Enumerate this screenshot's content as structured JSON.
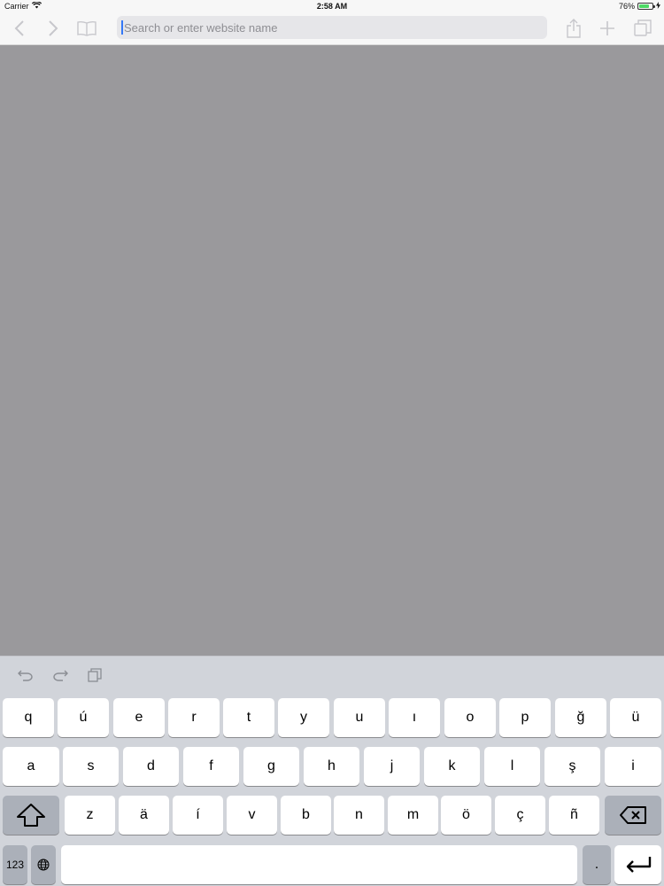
{
  "status_bar": {
    "carrier": "Carrier",
    "time": "2:58 AM",
    "battery": "76%"
  },
  "toolbar": {
    "search_placeholder": "Search or enter website name",
    "icons": [
      "back-icon",
      "forward-icon",
      "bookmarks-icon",
      "share-icon",
      "new-tab-icon",
      "tabs-icon"
    ]
  },
  "keyboard": {
    "shortcuts": [
      "undo-icon",
      "redo-icon",
      "paste-icon"
    ],
    "row1": [
      "q",
      "ú",
      "e",
      "r",
      "t",
      "y",
      "u",
      "ı",
      "o",
      "p",
      "ğ",
      "ü"
    ],
    "row2": [
      "a",
      "s",
      "d",
      "f",
      "g",
      "h",
      "j",
      "k",
      "l",
      "ş",
      "i"
    ],
    "row3": [
      "z",
      "ä",
      "í",
      "v",
      "b",
      "n",
      "m",
      "ö",
      "ç",
      "ñ"
    ],
    "numbers_key": "123",
    "period_key": ".",
    "colors": {
      "key_bg": "#ffffff",
      "function_key_bg": "#abb0b9",
      "keyboard_bg": "#d1d4da",
      "accent": "#3478f6",
      "content_bg": "#9a999c"
    }
  }
}
